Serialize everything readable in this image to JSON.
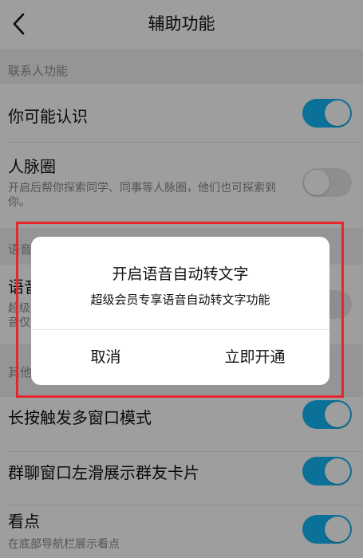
{
  "header": {
    "title": "辅助功能",
    "back_icon": "chevron-left-icon"
  },
  "sections": {
    "contacts": "联系人功能",
    "voice": "语音",
    "other": "其他"
  },
  "rows": {
    "maybe_know": {
      "title": "你可能认识",
      "toggle": "on"
    },
    "network": {
      "title": "人脉圈",
      "desc": "开启后帮你探索同学、同事等人脉圈，他们也可探索到你。",
      "toggle": "off"
    },
    "voice_row": {
      "title": "语音",
      "desc": "超级",
      "desc2": "音仅",
      "toggle": "off"
    },
    "long_press": {
      "title": "长按触发多窗口模式",
      "toggle": "on"
    },
    "group_swipe": {
      "title": "群聊窗口左滑展示群友卡片",
      "toggle": "on"
    },
    "kandian": {
      "title": "看点",
      "desc": "在底部导航栏展示看点",
      "toggle": "on"
    }
  },
  "dialog": {
    "title": "开启语音自动转文字",
    "message": "超级会员专享语音自动转文字功能",
    "cancel_label": "取消",
    "confirm_label": "立即开通"
  },
  "colors": {
    "accent": "#12b7f5",
    "highlight": "#e8262b"
  }
}
